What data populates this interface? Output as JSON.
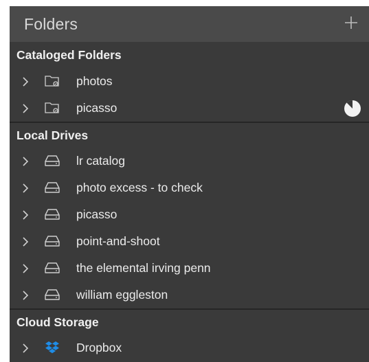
{
  "panel": {
    "title": "Folders",
    "add_icon": "plus-icon"
  },
  "sections": {
    "cataloged": {
      "title": "Cataloged Folders",
      "items": [
        {
          "label": "photos",
          "icon": "linked-folder-icon"
        },
        {
          "label": "picasso",
          "icon": "linked-folder-icon",
          "status_icon": "progress-pie-icon"
        }
      ]
    },
    "local": {
      "title": "Local Drives",
      "items": [
        {
          "label": "lr catalog",
          "icon": "drive-icon"
        },
        {
          "label": "photo excess - to check",
          "icon": "drive-icon"
        },
        {
          "label": "picasso",
          "icon": "drive-icon"
        },
        {
          "label": "point-and-shoot",
          "icon": "drive-icon"
        },
        {
          "label": "the elemental irving penn",
          "icon": "drive-icon"
        },
        {
          "label": "william eggleston",
          "icon": "drive-icon"
        }
      ]
    },
    "cloud": {
      "title": "Cloud Storage",
      "items": [
        {
          "label": "Dropbox",
          "icon": "dropbox-icon"
        }
      ]
    }
  },
  "colors": {
    "panel_bg": "#3a3a3a",
    "header_bg": "#4a4a4a",
    "dropbox_blue": "#1f8ce6"
  }
}
